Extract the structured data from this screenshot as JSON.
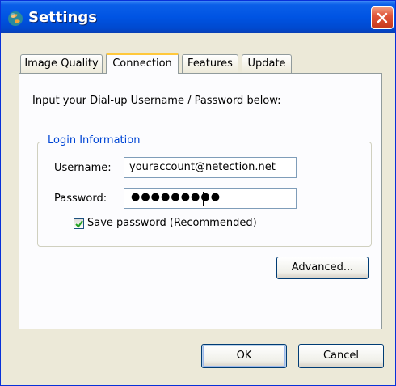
{
  "window": {
    "title": "Settings"
  },
  "tabs": [
    {
      "label": "Image Quality",
      "active": false
    },
    {
      "label": "Connection",
      "active": true
    },
    {
      "label": "Features",
      "active": false
    },
    {
      "label": "Update",
      "active": false
    }
  ],
  "connection": {
    "instruction": "Input your Dial-up Username / Password below:",
    "group_title": "Login Information",
    "username_label": "Username:",
    "username_value": "youraccount@netection.net",
    "password_label": "Password:",
    "password_mask": "●●●●●●●●●",
    "save_password_label": "Save password (Recommended)",
    "save_password_checked": true,
    "advanced_label": "Advanced..."
  },
  "buttons": {
    "ok": "OK",
    "cancel": "Cancel"
  },
  "icons": {
    "app": "globe-icon",
    "close": "close-icon",
    "check": "checkmark-icon"
  },
  "colors": {
    "titlebar": "#0054e3",
    "close": "#e0553a",
    "tab_highlight": "#ffc83c",
    "group_title": "#0046d5"
  }
}
